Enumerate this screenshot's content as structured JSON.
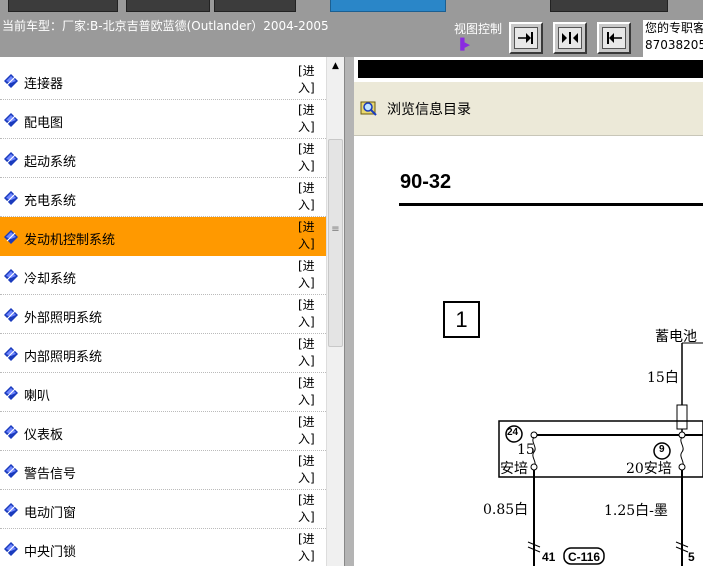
{
  "header": {
    "car_model": "当前车型：厂家:B-北京吉普欧蓝德(Outlander）2004-2005",
    "view_control_label": "视图控制",
    "side_info_line1": "您的专职客",
    "side_info_line2": "87038205"
  },
  "sidebar": {
    "items": [
      {
        "label": "连接器",
        "action": "[进入]"
      },
      {
        "label": "配电图",
        "action": "[进入]"
      },
      {
        "label": "起动系统",
        "action": "[进入]"
      },
      {
        "label": "充电系统",
        "action": "[进入]"
      },
      {
        "label": "发动机控制系统",
        "action": "[进入]",
        "active": true
      },
      {
        "label": "冷却系统",
        "action": "[进入]"
      },
      {
        "label": "外部照明系统",
        "action": "[进入]"
      },
      {
        "label": "内部照明系统",
        "action": "[进入]"
      },
      {
        "label": "喇叭",
        "action": "[进入]"
      },
      {
        "label": "仪表板",
        "action": "[进入]"
      },
      {
        "label": "警告信号",
        "action": "[进入]"
      },
      {
        "label": "电动门窗",
        "action": "[进入]"
      },
      {
        "label": "中央门锁",
        "action": "[进入]"
      }
    ]
  },
  "content": {
    "directory_label": "浏览信息目录",
    "diagram": {
      "page_number": "90-32",
      "box_number": "1",
      "battery_label": "蓄电池",
      "wire_15white": "15白",
      "conn24": "24",
      "fuse15": "15",
      "fuse15_amp": "安培",
      "conn9": "9",
      "fuse20_amp": "20安培",
      "wire_085white": "0.85白",
      "wire_125whiteblack": "1.25白-墨",
      "pin41": "41",
      "conn_c116": "C-116",
      "pin5": "5"
    }
  },
  "colors": {
    "active_item": "#ff9900",
    "icon_blue": "#1a3bbd",
    "header_bg": "#9a9a9a"
  }
}
